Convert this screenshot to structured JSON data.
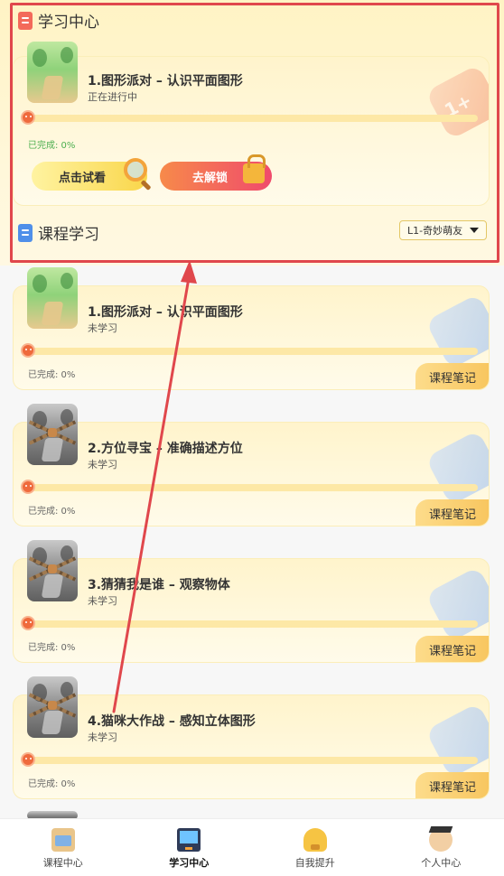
{
  "top_section": {
    "title": "学习中心",
    "current_course": {
      "title": "1.图形派对 – 认识平面图形",
      "status": "正在进行中",
      "progress_label": "已完成: 0%",
      "progress": 0,
      "try_button": "点击试看",
      "unlock_button": "去解锁",
      "deco_text": "1+"
    }
  },
  "course_section": {
    "title": "课程学习",
    "level_selector": "L1-奇妙萌友"
  },
  "courses": [
    {
      "title": "1.图形派对 – 认识平面图形",
      "status": "未学习",
      "progress_label": "已完成: 0%",
      "progress": 0,
      "note_button": "课程笔记"
    },
    {
      "title": "2.方位寻宝 – 准确描述方位",
      "status": "未学习",
      "progress_label": "已完成: 0%",
      "progress": 0,
      "note_button": "课程笔记"
    },
    {
      "title": "3.猜猜我是谁 – 观察物体",
      "status": "未学习",
      "progress_label": "已完成: 0%",
      "progress": 0,
      "note_button": "课程笔记"
    },
    {
      "title": "4.猫咪大作战 – 感知立体图形",
      "status": "未学习",
      "progress_label": "已完成: 0%",
      "progress": 0,
      "note_button": "课程笔记"
    }
  ],
  "tabbar": {
    "items": [
      {
        "label": "课程中心",
        "icon": "school-bag-icon"
      },
      {
        "label": "学习中心",
        "icon": "monitor-icon",
        "active": true
      },
      {
        "label": "自我提升",
        "icon": "trophy-icon"
      },
      {
        "label": "个人中心",
        "icon": "graduate-avatar-icon"
      }
    ]
  },
  "colors": {
    "highlight_border": "#e0474c",
    "annotation_arrow": "#e0474c",
    "card_bg": "#fff4cc",
    "unlock_button": "#f04b6c",
    "try_button": "#f9d64a"
  }
}
